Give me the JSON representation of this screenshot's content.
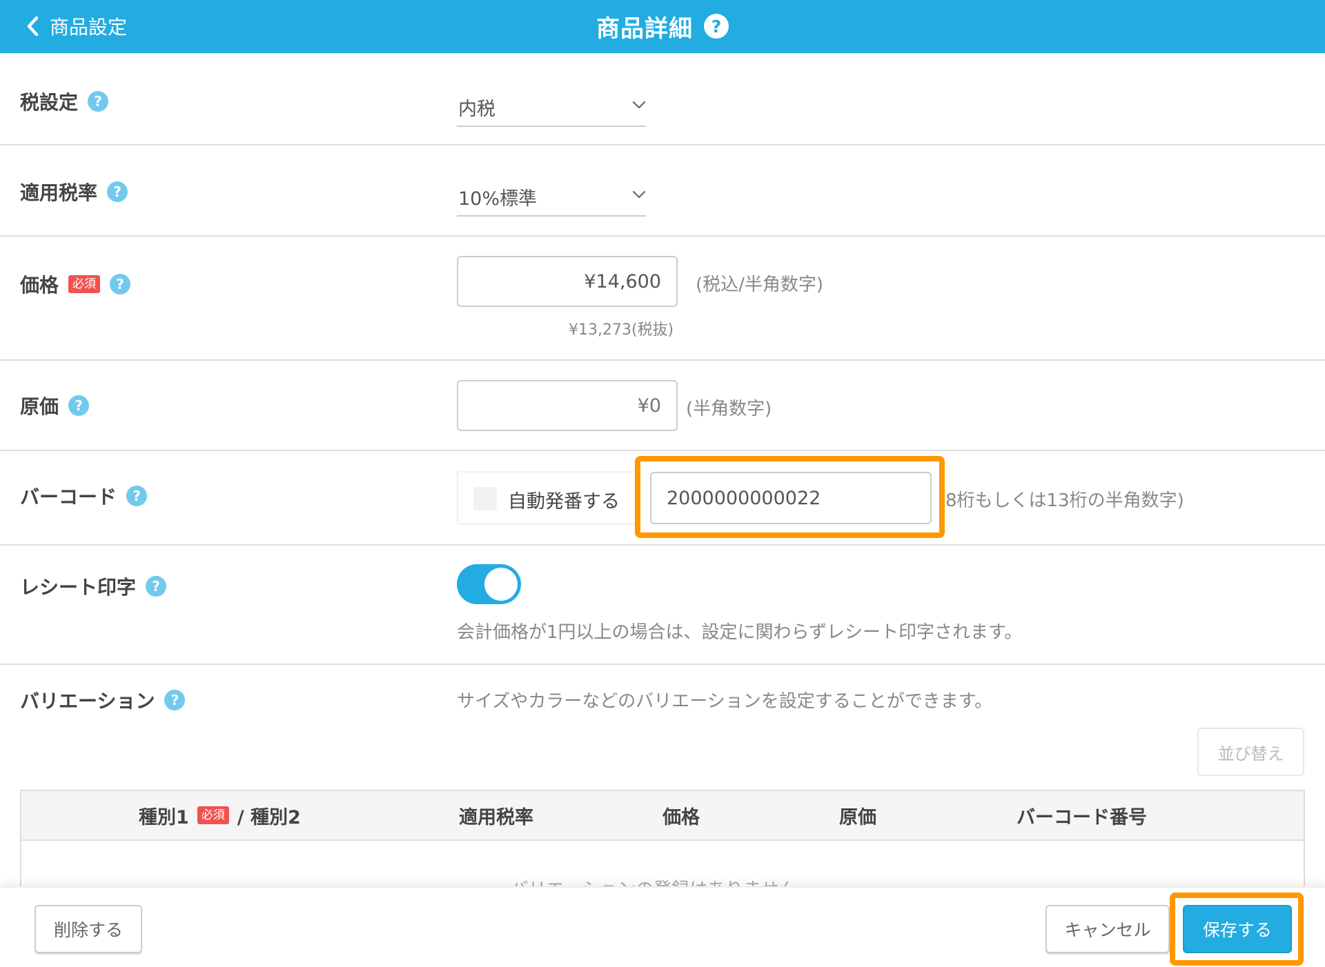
{
  "header": {
    "back_label": "商品設定",
    "title": "商品詳細",
    "help_symbol": "?"
  },
  "form": {
    "tax_setting": {
      "label": "税設定",
      "value": "内税"
    },
    "tax_rate": {
      "label": "適用税率",
      "value": "10%標準"
    },
    "price": {
      "label": "価格",
      "required_badge": "必須",
      "value": "¥14,600",
      "hint": "(税込/半角数字)",
      "tax_excluded": "¥13,273(税抜)"
    },
    "cost": {
      "label": "原価",
      "placeholder": "¥0",
      "hint": "(半角数字)"
    },
    "barcode": {
      "label": "バーコード",
      "auto_number_label": "自動発番する",
      "auto_number_checked": false,
      "value": "2000000000022",
      "hint": "8桁もしくは13桁の半角数字)"
    },
    "receipt_print": {
      "label": "レシート印字",
      "enabled": true,
      "note": "会計価格が1円以上の場合は、設定に関わらずレシート印字されます。"
    },
    "variation": {
      "label": "バリエーション",
      "description": "サイズやカラーなどのバリエーションを設定することができます。",
      "sort_button": "並び替え",
      "table": {
        "col_type1": "種別1",
        "col_required_badge": "必須",
        "col_type2": "/ 種別2",
        "col_tax_rate": "適用税率",
        "col_price": "価格",
        "col_cost": "原価",
        "col_barcode": "バーコード番号",
        "empty_message": "バリエーションの登録はありません。"
      }
    }
  },
  "footer": {
    "delete_label": "削除する",
    "cancel_label": "キャンセル",
    "save_label": "保存する"
  },
  "colors": {
    "brand": "#22ace2",
    "highlight": "#ff9800",
    "required": "#ef5350",
    "help_icon": "#72c9ee"
  },
  "icons": {
    "back": "chevron-left-icon",
    "select": "chevron-down-icon",
    "help": "question-circle-icon"
  }
}
